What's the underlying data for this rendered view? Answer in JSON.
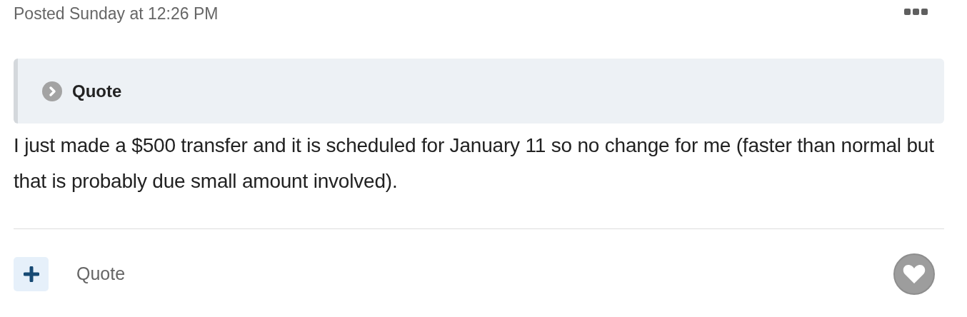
{
  "post_meta": {
    "posted": "Posted Sunday at 12:26 PM"
  },
  "quote": {
    "title": "Quote",
    "expanded": false
  },
  "body": "I just made a $500 transfer and it is scheduled for January 11 so no change for me (faster than normal but that is probably due small amount involved).",
  "footer": {
    "quote_link": "Quote"
  }
}
